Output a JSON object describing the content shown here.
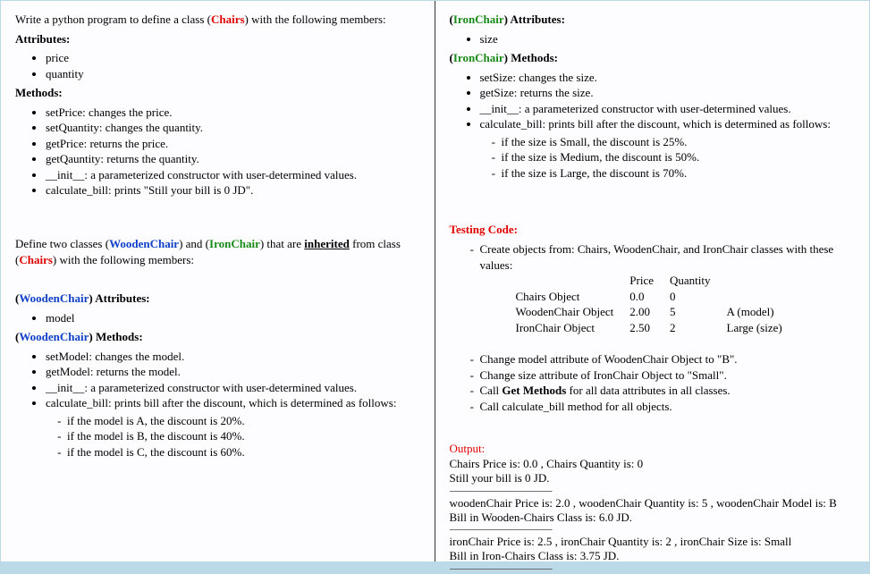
{
  "left": {
    "intro_a": "Write a python program to define a class (",
    "intro_class": "Chairs",
    "intro_b": ") with the following members:",
    "attr_head": "Attributes:",
    "attrs": [
      "price",
      "quantity"
    ],
    "meth_head": "Methods:",
    "methods": [
      "setPrice: changes the price.",
      "setQuantity: changes the quantity.",
      "getPrice: returns the price.",
      "getQauntity: returns the quantity.",
      "__init__: a parameterized constructor with user-determined values.",
      "calculate_bill: prints \"Still your bill is 0 JD\"."
    ],
    "define_a": "Define two classes (",
    "define_w": "WoodenChair",
    "define_b": ") and (",
    "define_i": "IronChair",
    "define_c": ") that are ",
    "define_u": "inherited",
    "define_d": " from class (",
    "define_ch": "Chairs",
    "define_e": ") with the following members:",
    "wc_attr_head_a": "(",
    "wc_attr_head_b": ") Attributes:",
    "wc_attrs": [
      "model"
    ],
    "wc_meth_head_a": "(",
    "wc_meth_head_b": ") Methods:",
    "wc_methods": [
      "setModel: changes the model.",
      "getModel: returns the model.",
      "__init__: a parameterized constructor with user-determined values."
    ],
    "wc_calc": "calculate_bill: prints bill after the discount, which is determined as follows:",
    "wc_rules": [
      "if the model is A, the discount is 20%.",
      "if the model is B, the discount is 40%.",
      "if the model is C, the discount is 60%."
    ]
  },
  "right": {
    "ic_attr_head_a": "(",
    "ic_name": "IronChair",
    "ic_attr_head_b": ") Attributes:",
    "ic_attrs": [
      "size"
    ],
    "ic_meth_head_a": "(",
    "ic_meth_head_b": ") Methods:",
    "ic_methods": [
      "setSize: changes the size.",
      "getSize: returns the size.",
      "__init__: a parameterized constructor with user-determined values."
    ],
    "ic_calc": "calculate_bill: prints bill after the discount, which is determined as follows:",
    "ic_rules": [
      "if the size is Small, the discount is 25%.",
      "if the size is Medium, the discount is 50%.",
      "if the size is Large, the discount is 70%."
    ],
    "testing_head": "Testing Code:",
    "test_create": "Create objects from: Chairs, WoodenChair, and IronChair classes with these values:",
    "table_head": [
      "",
      "Price",
      "Quantity",
      ""
    ],
    "table_rows": [
      [
        "Chairs Object",
        "0.0",
        "0",
        ""
      ],
      [
        "WoodenChair Object",
        "2.00",
        "5",
        "A (model)"
      ],
      [
        "IronChair Object",
        "2.50",
        "2",
        "Large (size)"
      ]
    ],
    "steps": [
      "Change model attribute of WoodenChair Object to \"B\".",
      "Change size attribute of IronChair Object to \"Small\".",
      "Call Get Methods for all data attributes in all classes.",
      "Call calculate_bill method for all objects."
    ],
    "output_head": "Output:",
    "out_lines": [
      "Chairs Price is: 0.0 , Chairs Quantity is: 0",
      "Still your bill is 0 JD.",
      "---",
      "woodenChair Price is: 2.0 , woodenChair Quantity is: 5 , woodenChair Model is: B",
      "Bill in Wooden-Chairs Class is: 6.0 JD.",
      "---",
      "ironChair Price is: 2.5 , ironChair Quantity is: 2 , ironChair Size is: Small",
      "Bill in Iron-Chairs Class is: 3.75 JD.",
      "---"
    ],
    "dashes": "-------------------------------------------"
  }
}
